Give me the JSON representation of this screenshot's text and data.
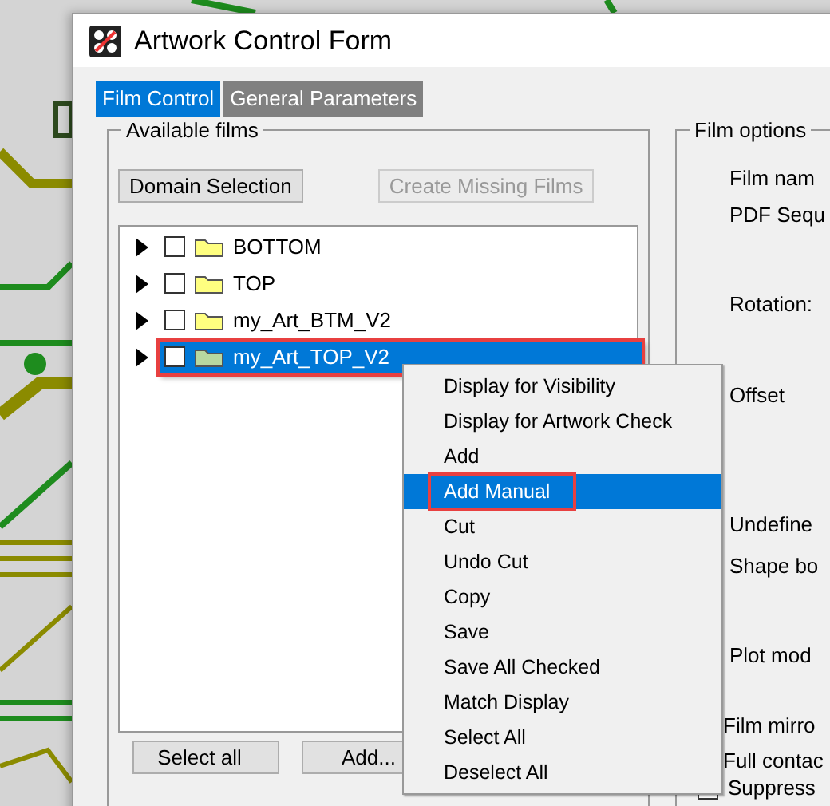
{
  "window": {
    "title": "Artwork Control Form"
  },
  "tabs": [
    {
      "label": "Film Control",
      "selected": true
    },
    {
      "label": "General Parameters",
      "selected": false
    }
  ],
  "available_films": {
    "title": "Available films",
    "buttons": [
      {
        "label": "Domain Selection",
        "disabled": false
      },
      {
        "label": "Create Missing Films",
        "disabled": true
      }
    ],
    "films": [
      {
        "name": "BOTTOM",
        "checked": false,
        "selected": false,
        "outlined": false
      },
      {
        "name": "TOP",
        "checked": false,
        "selected": false,
        "outlined": false
      },
      {
        "name": "my_Art_BTM_V2",
        "checked": false,
        "selected": false,
        "outlined": false
      },
      {
        "name": "my_Art_TOP_V2",
        "checked": false,
        "selected": true,
        "outlined": true
      }
    ],
    "bottom_buttons": [
      "Select all",
      "Add..."
    ]
  },
  "context_menu": [
    {
      "label": "Display for Visibility",
      "selected": false,
      "outlined": false
    },
    {
      "label": "Display for Artwork Check",
      "selected": false,
      "outlined": false
    },
    {
      "label": "Add",
      "selected": false,
      "outlined": false
    },
    {
      "label": "Add Manual",
      "selected": true,
      "outlined": true
    },
    {
      "label": "Cut",
      "selected": false,
      "outlined": false
    },
    {
      "label": "Undo Cut",
      "selected": false,
      "outlined": false
    },
    {
      "label": "Copy",
      "selected": false,
      "outlined": false
    },
    {
      "label": "Save",
      "selected": false,
      "outlined": false
    },
    {
      "label": "Save All Checked",
      "selected": false,
      "outlined": false
    },
    {
      "label": "Match Display",
      "selected": false,
      "outlined": false
    },
    {
      "label": "Select All",
      "selected": false,
      "outlined": false
    },
    {
      "label": "Deselect All",
      "selected": false,
      "outlined": false
    }
  ],
  "film_options": {
    "title": "Film options",
    "fields": [
      {
        "kind": "label",
        "label": "Film nam"
      },
      {
        "kind": "label",
        "label": "PDF Sequ"
      },
      {
        "kind": "label",
        "label": "Rotation:"
      },
      {
        "kind": "label",
        "label": "Offset"
      },
      {
        "kind": "label",
        "label": "Undefine"
      },
      {
        "kind": "label",
        "label": "Shape bo"
      },
      {
        "kind": "label",
        "label": "Plot mod"
      },
      {
        "kind": "option",
        "label": "Film mirro"
      },
      {
        "kind": "option",
        "label": "Full contac"
      },
      {
        "kind": "checkbox",
        "label": "Suppress",
        "checked": false
      }
    ]
  }
}
